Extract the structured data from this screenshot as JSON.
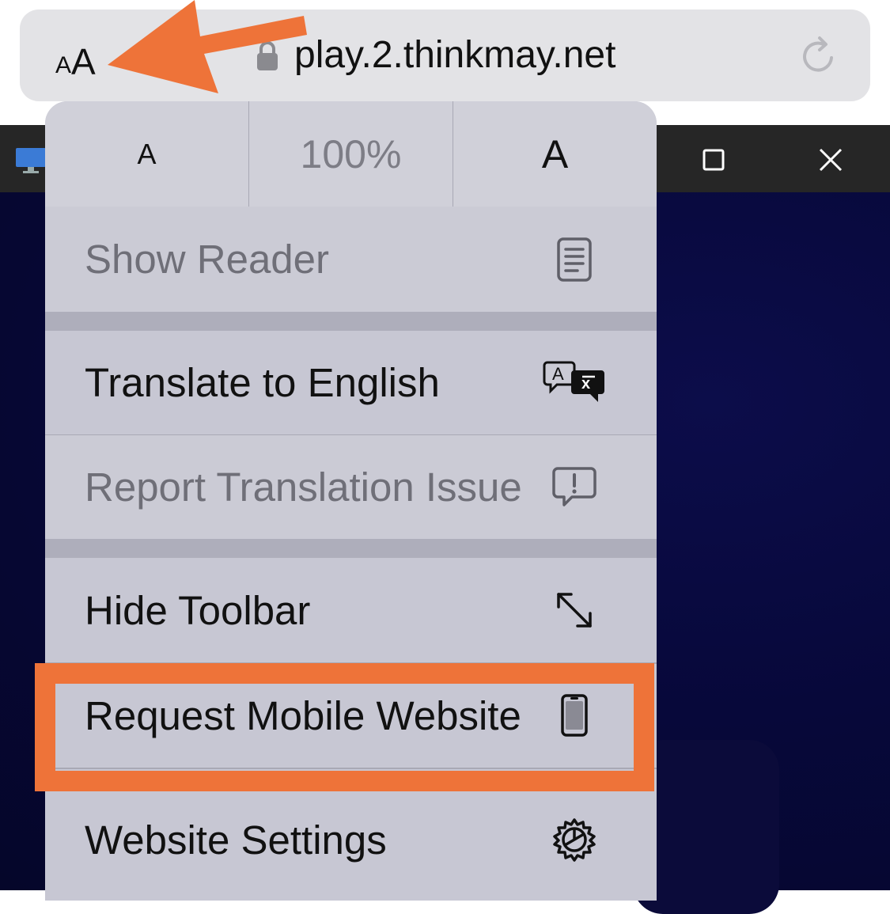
{
  "browser": {
    "text_size_button": {
      "small": "A",
      "large": "A"
    },
    "url": "play.2.thinkmay.net"
  },
  "menu": {
    "zoom": {
      "decrease_label": "A",
      "level": "100%",
      "increase_label": "A"
    },
    "items": [
      {
        "label": "Show Reader",
        "icon": "reader-icon",
        "enabled": false
      },
      {
        "label": "Translate to English",
        "icon": "translate-icon",
        "enabled": true
      },
      {
        "label": "Report Translation Issue",
        "icon": "report-bubble-icon",
        "enabled": false
      },
      {
        "label": "Hide Toolbar",
        "icon": "resize-arrows-icon",
        "enabled": true
      },
      {
        "label": "Request Mobile Website",
        "icon": "phone-icon",
        "enabled": true,
        "highlighted": true
      },
      {
        "label": "Website Settings",
        "icon": "gear-icon",
        "enabled": true
      }
    ]
  },
  "annotation": {
    "color": "#ee7339",
    "arrow_target": "text-size-button",
    "box_target": "request-mobile-website"
  },
  "colors": {
    "menu_bg": "#c7c7d3",
    "address_bar_bg": "#e3e3e6",
    "page_bg": "#05062a"
  }
}
